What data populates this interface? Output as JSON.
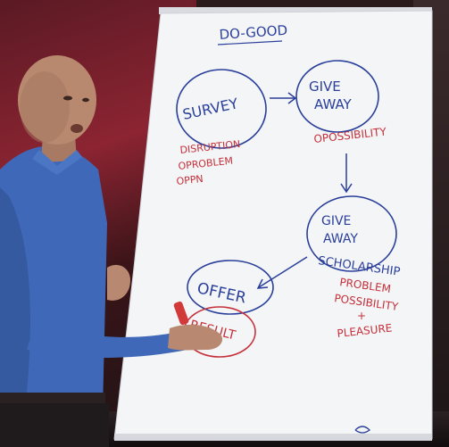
{
  "image": {
    "subject": "presenter",
    "colors": {
      "board": "#f4f5f7",
      "marker_blue": "#2a3f9a",
      "marker_red": "#c5303a",
      "shirt": "#3f69b8"
    }
  },
  "flipchart": {
    "heading": "DO-GOOD",
    "circles": [
      {
        "label_lines": [
          "SURVEY"
        ]
      },
      {
        "label_lines": [
          "GIVE",
          "AWAY"
        ]
      },
      {
        "label_lines": [
          "GIVE",
          "AWAY",
          "SCHOLARSHIP"
        ]
      },
      {
        "label_lines": [
          "OFFER"
        ]
      },
      {
        "label_lines": [
          "RESULT"
        ]
      }
    ],
    "notes": [
      {
        "lines": [
          "DISRUPTION",
          "OPROBLEM",
          "OPPN"
        ]
      },
      {
        "lines": [
          "OPOSSIBILITY"
        ]
      },
      {
        "lines": [
          "PROBLEM",
          "POSSIBILITY",
          "+",
          "PLEASURE"
        ]
      }
    ]
  }
}
